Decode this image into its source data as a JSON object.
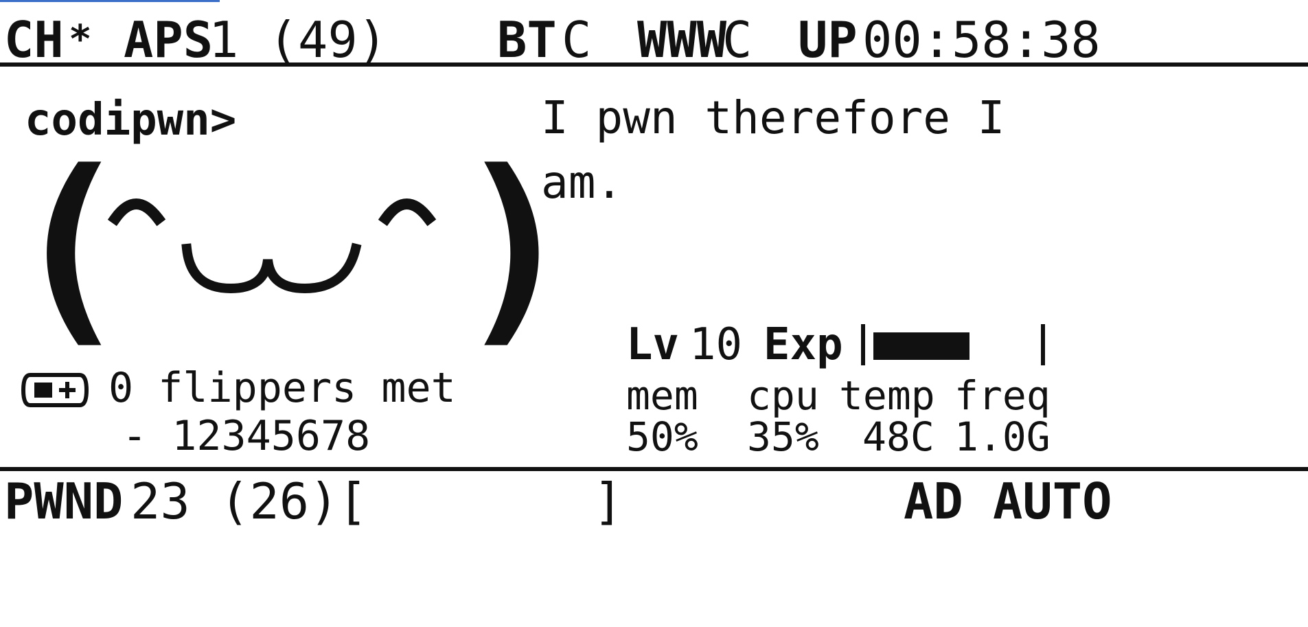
{
  "top_bar": {
    "channel_label": "CH",
    "channel_value": "*",
    "aps_label": "APS",
    "aps_value": "1 (49)",
    "bt_label": "BT",
    "bt_value": "C",
    "www_label": "WWW",
    "www_value": "C",
    "up_label": "UP",
    "uptime": "00:58:38"
  },
  "main": {
    "name": "codipwn>",
    "face": {
      "left_paren": "(",
      "right_paren": ")"
    },
    "status_line1": "I pwn therefore I",
    "status_line2": "am."
  },
  "flippers": {
    "count_text": "0 flippers met",
    "id_text": "- 12345678"
  },
  "level": {
    "label": "Lv",
    "value": "10",
    "exp_label": "Exp",
    "exp_progress": 0.4
  },
  "stats": {
    "headers": [
      "mem",
      "cpu",
      "temp",
      "freq"
    ],
    "values": [
      "50%",
      "35%",
      "48C",
      "1.0G"
    ]
  },
  "bottom_bar": {
    "pwnd_label": "PWND",
    "pwnd_value": "23 (26)",
    "bracket_open": "[",
    "bracket_close": "]",
    "mode": "AD AUTO"
  },
  "colors": {
    "foreground": "#111111",
    "background": "#ffffff",
    "top_accent": "#3b6fc8"
  }
}
